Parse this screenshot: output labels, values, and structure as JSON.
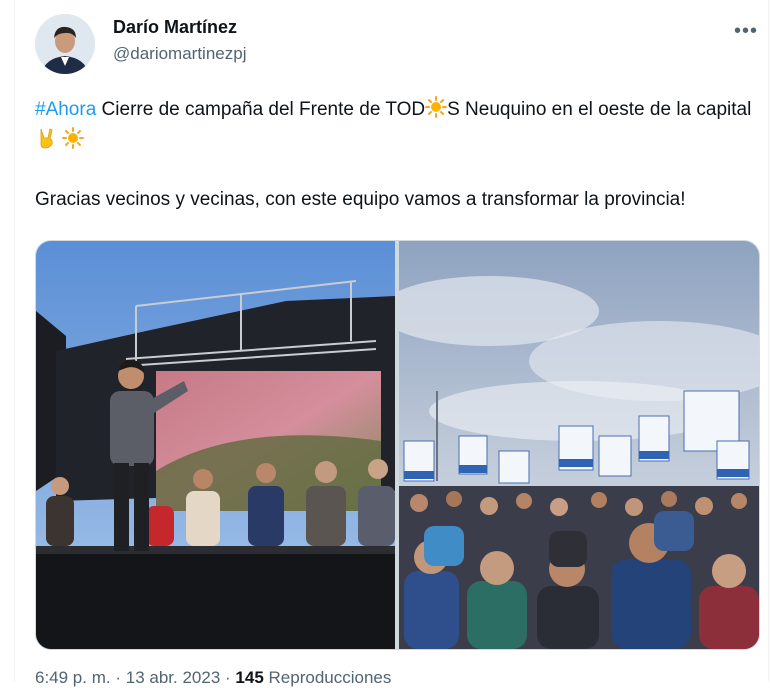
{
  "tweet": {
    "author_name": "Darío Martínez",
    "author_handle": "@dariomartinezpj",
    "more_icon": "more-dots-icon",
    "text": {
      "hashtag": "#Ahora",
      "line1_part1": " Cierre de campaña del Frente de TOD",
      "line1_part2": "S Neuquino en el oeste de la capital ",
      "paragraph2": "Gracias vecinos y vecinas, con este equipo vamos a transformar la provincia!"
    },
    "emojis": [
      "sun-emoji",
      "victory-hand-emoji",
      "sun-emoji"
    ],
    "media": [
      {
        "name": "stage-photo"
      },
      {
        "name": "crowd-photo"
      }
    ],
    "meta": {
      "time": "6:49 p. m.",
      "separator": "·",
      "date": "13 abr. 2023",
      "views_count": "145",
      "views_label": "Reproducciones"
    }
  },
  "colors": {
    "text": "#0f1419",
    "secondary": "#536471",
    "link": "#1d9bf0",
    "border": "#cfd9de"
  }
}
